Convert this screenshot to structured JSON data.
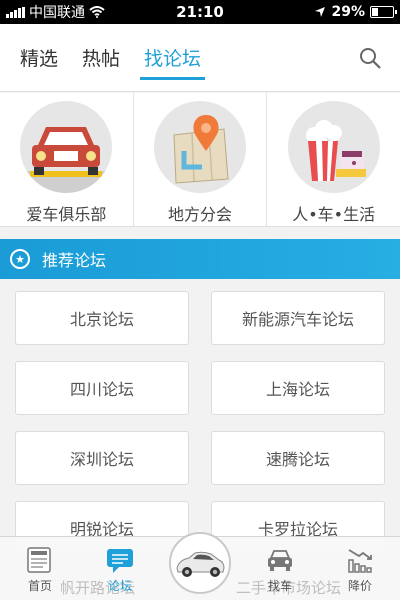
{
  "status_bar": {
    "carrier": "中国联通",
    "time": "21:10",
    "battery": "29%",
    "battery_level": 0.29
  },
  "top_tabs": [
    {
      "label": "精选",
      "active": false
    },
    {
      "label": "热帖",
      "active": false
    },
    {
      "label": "找论坛",
      "active": true
    }
  ],
  "categories": [
    {
      "label": "爱车俱乐部",
      "icon": "car-club-icon"
    },
    {
      "label": "地方分会",
      "icon": "map-pin-icon"
    },
    {
      "label": "人•车•生活",
      "icon": "popcorn-icon"
    }
  ],
  "recommended": {
    "title": "推荐论坛",
    "forums": [
      "北京论坛",
      "新能源汽车论坛",
      "四川论坛",
      "上海论坛",
      "深圳论坛",
      "速腾论坛",
      "明锐论坛",
      "卡罗拉论坛"
    ],
    "partially_hidden": [
      "帆开路论坛",
      "二手车市场论坛"
    ]
  },
  "bottom_nav": [
    {
      "label": "首页",
      "icon": "news-icon",
      "active": false
    },
    {
      "label": "论坛",
      "icon": "chat-icon",
      "active": true
    },
    {
      "label": "",
      "icon": "car-center-icon",
      "active": false
    },
    {
      "label": "找车",
      "icon": "find-car-icon",
      "active": false
    },
    {
      "label": "降价",
      "icon": "price-drop-icon",
      "active": false
    }
  ],
  "colors": {
    "accent": "#1fa0d8",
    "background": "#f2f2f2"
  }
}
